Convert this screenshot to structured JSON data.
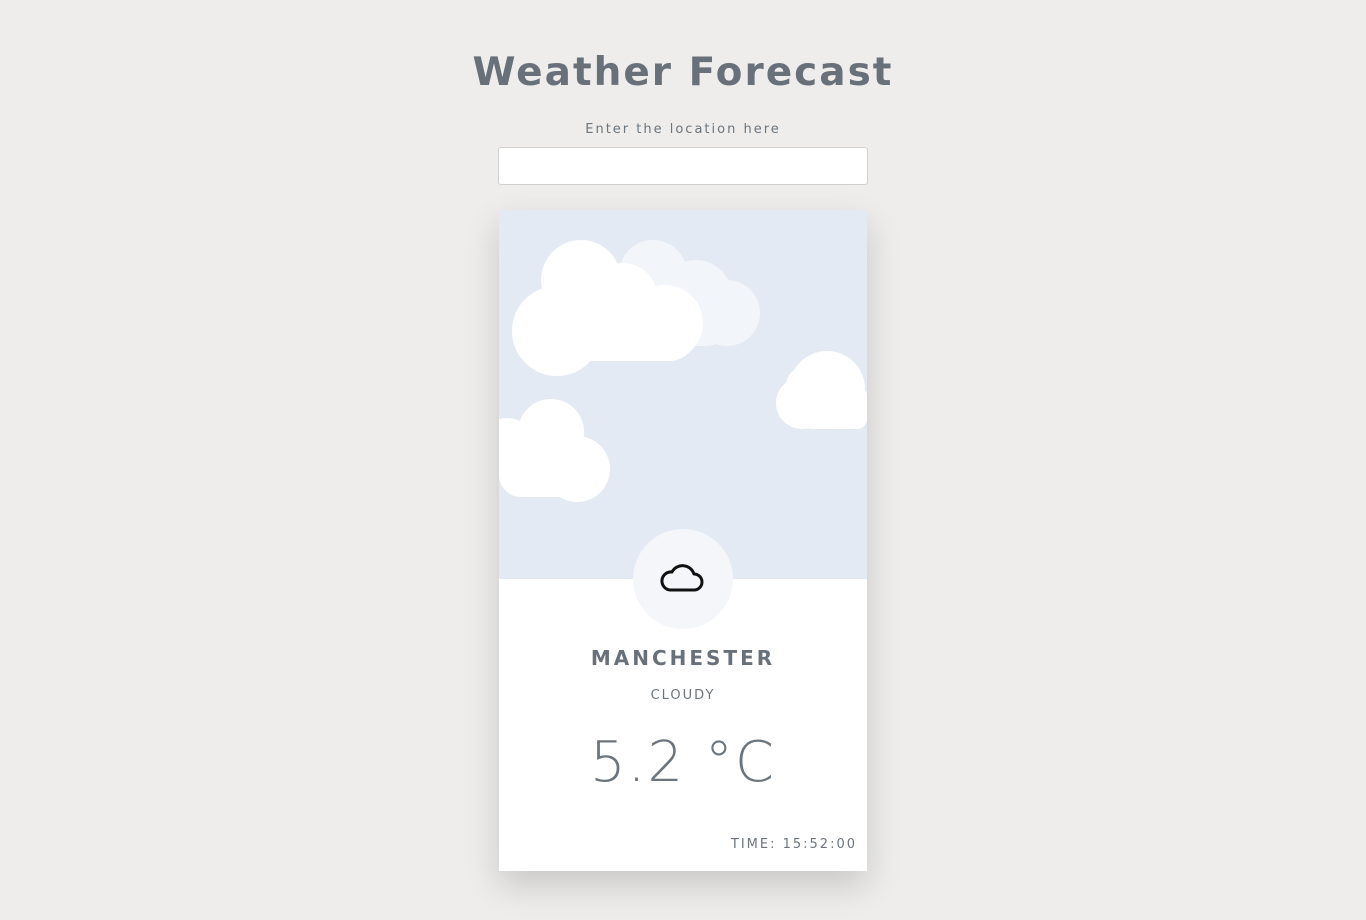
{
  "header": {
    "title": "Weather Forecast"
  },
  "search": {
    "label": "Enter the location here",
    "value": "",
    "placeholder": ""
  },
  "weather": {
    "city": "MANCHESTER",
    "condition": "CLOUDY",
    "temperature": "5.2 °C",
    "time": "TIME: 15:52:00",
    "icon": "cloud-icon"
  },
  "colors": {
    "background": "#eeedeb",
    "sky": "#e4eaf4",
    "card": "#ffffff",
    "text": "#6c757d"
  }
}
